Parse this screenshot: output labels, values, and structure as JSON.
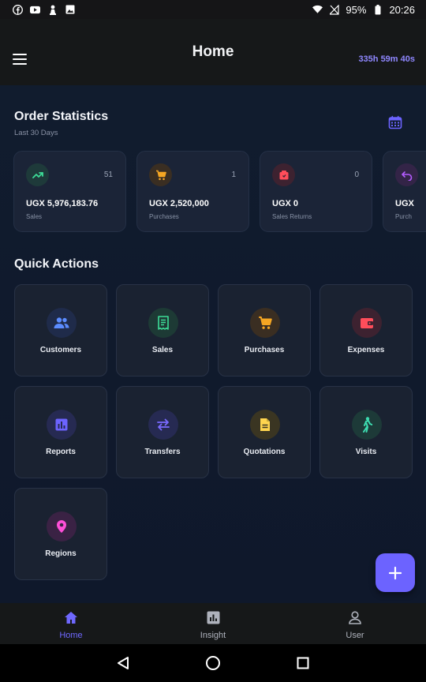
{
  "status_bar": {
    "battery": "95%",
    "time": "20:26",
    "left_icons": [
      "facebook-icon",
      "youtube-icon",
      "chess-pawn-icon",
      "image-icon"
    ],
    "right_icons": [
      "wifi-icon",
      "no-signal-icon",
      "battery-icon"
    ]
  },
  "header": {
    "title": "Home",
    "timer": "335h 59m 40s",
    "menu_icon": "hamburger-menu-icon"
  },
  "order_statistics": {
    "title": "Order Statistics",
    "subtitle": "Last 30 Days",
    "calendar_icon": "calendar-icon",
    "cards": [
      {
        "icon": "trending-up-icon",
        "count": "51",
        "value": "UGX 5,976,183.76",
        "label": "Sales",
        "accent": "#3ddc97",
        "icon_bg": "#1e3a3a"
      },
      {
        "icon": "cart-icon",
        "count": "1",
        "value": "UGX 2,520,000",
        "label": "Purchases",
        "accent": "#f5a623",
        "icon_bg": "#3a2e22"
      },
      {
        "icon": "return-box-icon",
        "count": "0",
        "value": "UGX 0",
        "label": "Sales Returns",
        "accent": "#ff4d5a",
        "icon_bg": "#3d2230"
      },
      {
        "icon": "undo-icon",
        "count": "",
        "value": "UGX",
        "label": "Purch",
        "accent": "#b45cff",
        "icon_bg": "#332447"
      }
    ]
  },
  "quick_actions": {
    "title": "Quick Actions",
    "items": [
      {
        "label": "Customers",
        "icon": "people-icon",
        "accent": "#5b8cff",
        "icon_bg": "#1f2b4a"
      },
      {
        "label": "Sales",
        "icon": "receipt-icon",
        "accent": "#3ddc97",
        "icon_bg": "#1d3a35"
      },
      {
        "label": "Purchases",
        "icon": "cart-icon",
        "accent": "#f5a623",
        "icon_bg": "#3a2e22"
      },
      {
        "label": "Expenses",
        "icon": "wallet-icon",
        "accent": "#ff4d5a",
        "icon_bg": "#3d2230"
      },
      {
        "label": "Reports",
        "icon": "bar-chart-icon",
        "accent": "#6c63ff",
        "icon_bg": "#262a52"
      },
      {
        "label": "Transfers",
        "icon": "swap-arrows-icon",
        "accent": "#7a6bff",
        "icon_bg": "#262a52"
      },
      {
        "label": "Quotations",
        "icon": "document-icon",
        "accent": "#ffd54f",
        "icon_bg": "#3a3522"
      },
      {
        "label": "Visits",
        "icon": "walking-person-icon",
        "accent": "#3ddcb0",
        "icon_bg": "#1d3a38"
      },
      {
        "label": "Regions",
        "icon": "location-pin-icon",
        "accent": "#ff4fd8",
        "icon_bg": "#3a2244"
      }
    ]
  },
  "fab": {
    "icon": "plus-icon",
    "color": "#6c63ff"
  },
  "bottom_nav": [
    {
      "label": "Home",
      "icon": "home-icon",
      "active": true
    },
    {
      "label": "Insight",
      "icon": "insight-chart-icon",
      "active": false
    },
    {
      "label": "User",
      "icon": "user-icon",
      "active": false
    }
  ],
  "system_nav": [
    "back-icon",
    "home-circle-icon",
    "recents-icon"
  ]
}
